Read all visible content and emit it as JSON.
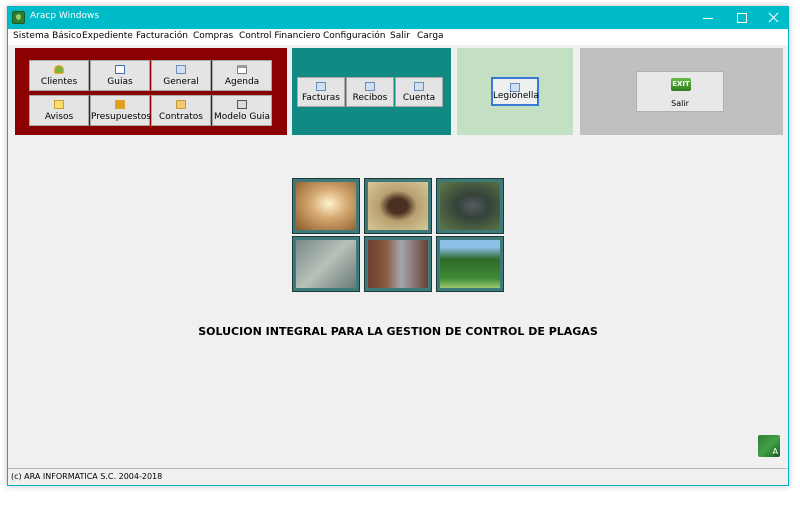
{
  "window": {
    "title": "Aracp Windows"
  },
  "menu": [
    "Sistema Básico",
    "Expediente",
    "Facturación",
    "Compras",
    "Control Financiero",
    "Configuración",
    "Salir",
    "Carga"
  ],
  "toolbar": {
    "main": [
      {
        "label": "Clientes",
        "icon": "user-icon"
      },
      {
        "label": "Guias",
        "icon": "document-icon"
      },
      {
        "label": "General",
        "icon": "grid-icon"
      },
      {
        "label": "Agenda",
        "icon": "calendar-icon"
      },
      {
        "label": "Avisos",
        "icon": "note-icon"
      },
      {
        "label": "Presupuestos",
        "icon": "pencil-icon"
      },
      {
        "label": "Contratos",
        "icon": "folder-icon"
      },
      {
        "label": "Modelo Guia",
        "icon": "printer-icon"
      }
    ],
    "billing": [
      {
        "label": "Facturas",
        "icon": "grid-icon"
      },
      {
        "label": "Recibos",
        "icon": "grid-icon"
      },
      {
        "label": "Cuenta",
        "icon": "grid-icon"
      }
    ],
    "legionella": {
      "label": "Legionella",
      "icon": "grid-icon"
    },
    "exit": {
      "image_text": "EXIT",
      "label": "Salir"
    }
  },
  "pest_images": [
    "termite-image",
    "cockroach-image",
    "rat-image",
    "mouse-image",
    "pigeon-image",
    "tree-image"
  ],
  "tagline": "SOLUCION INTEGRAL PARA LA GESTION DE CONTROL DE PLAGAS",
  "status": "(c) ARA INFORMATICA S.C. 2004-2018",
  "colors": {
    "titlebar": "#00bcc8",
    "panel_red": "#8b0000",
    "panel_teal": "#118a84",
    "panel_green": "#c4e0c4",
    "panel_gray": "#c0c0c0"
  }
}
